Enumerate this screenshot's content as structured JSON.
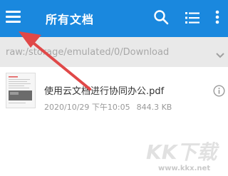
{
  "appbar": {
    "title": "所有文档",
    "background": "#1a88de",
    "menu_icon": "menu-icon",
    "search_icon": "search-icon",
    "list_icon": "list-view-icon",
    "more_icon": "more-vert-icon"
  },
  "pathbar": {
    "path": "raw:/storage/emulated/0/Download",
    "chevron_icon": "chevron-down-icon"
  },
  "files": [
    {
      "name": "使用云文档进行协同办公.pdf",
      "date": "2020/10/29 下午10:05",
      "size": "844.3 KB",
      "info_icon": "info-icon"
    }
  ],
  "annotation": {
    "arrow_color": "#e04848"
  },
  "watermark": {
    "logo_text": "KK下载",
    "url": "www.kkx.net"
  }
}
